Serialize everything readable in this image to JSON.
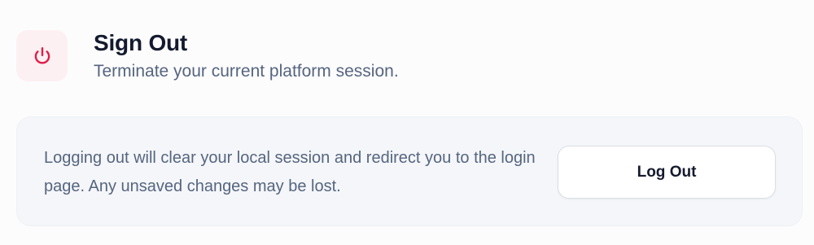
{
  "header": {
    "icon": "power-icon",
    "title": "Sign Out",
    "subtitle": "Terminate your current platform session."
  },
  "card": {
    "description": "Logging out will clear your local session and redirect you to the login page. Any unsaved changes may be lost.",
    "button_label": "Log Out"
  },
  "colors": {
    "accent": "#e11d48",
    "icon_background": "#fdf0f2",
    "title": "#141a2e",
    "muted_text": "#56657f",
    "card_background": "#f4f6f9"
  }
}
